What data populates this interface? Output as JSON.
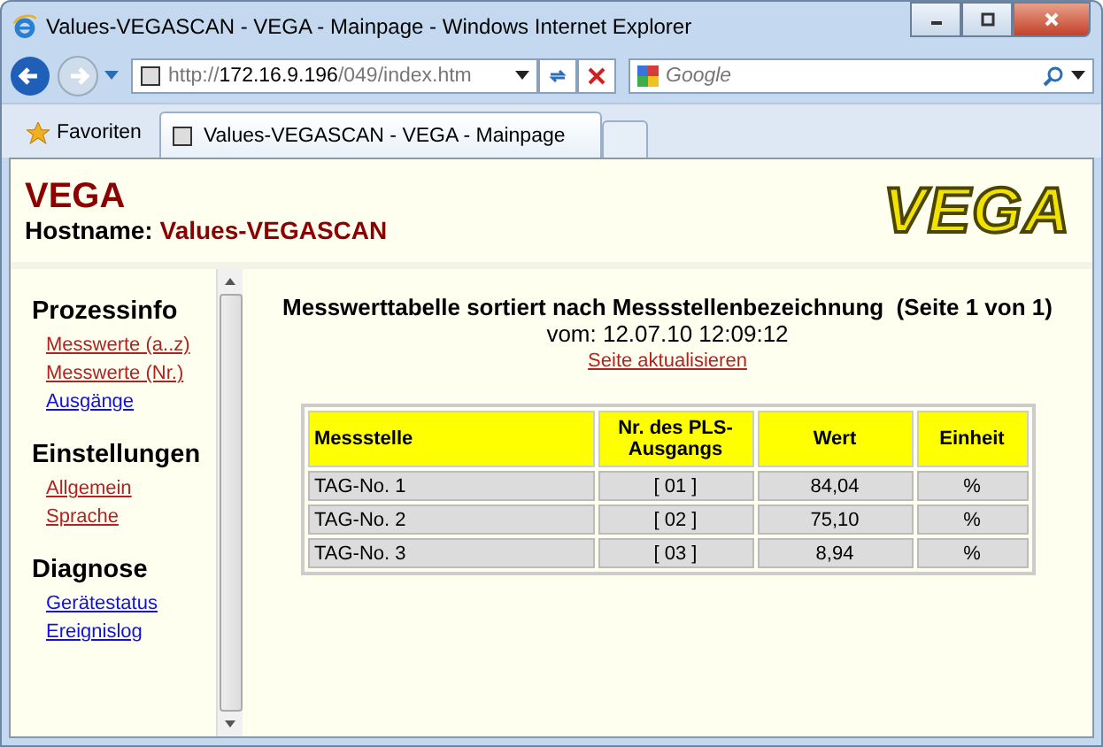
{
  "window": {
    "title": "Values-VEGASCAN - VEGA - Mainpage - Windows Internet Explorer"
  },
  "address_bar": {
    "prefix": "http://",
    "host": "172.16.9.196",
    "path": "/049/index.htm"
  },
  "search": {
    "placeholder": "Google"
  },
  "favorites": "Favoriten",
  "tabs": [
    {
      "label": "Values-VEGASCAN - VEGA - Mainpage",
      "selected": true
    }
  ],
  "header": {
    "title": "VEGA",
    "hostname_label": "Hostname:",
    "hostname": "Values-VEGASCAN",
    "logo": "VEGA"
  },
  "sidebar": {
    "sections": [
      {
        "title": "Prozessinfo",
        "links": [
          {
            "label": "Messwerte (a..z)",
            "visited": true
          },
          {
            "label": "Messwerte (Nr.)",
            "visited": true
          },
          {
            "label": "Ausgänge",
            "visited": false
          }
        ]
      },
      {
        "title": "Einstellungen",
        "links": [
          {
            "label": "Allgemein",
            "visited": true
          },
          {
            "label": "Sprache",
            "visited": true
          }
        ]
      },
      {
        "title": "Diagnose",
        "links": [
          {
            "label": "Gerätestatus",
            "visited": false
          },
          {
            "label": "Ereignislog",
            "visited": false
          }
        ]
      }
    ]
  },
  "main": {
    "heading": "Messwerttabelle sortiert nach Messstellenbezeichnung  (Seite 1 von 1)",
    "timestamp": "vom: 12.07.10 12:09:12",
    "refresh_link": {
      "label": "Seite aktualisieren",
      "visited": true
    }
  },
  "table": {
    "columns": [
      "Messstelle",
      "Nr. des PLS-Ausgangs",
      "Wert",
      "Einheit"
    ],
    "rows": [
      [
        "TAG-No. 1",
        "[ 01 ]",
        "84,04",
        "%"
      ],
      [
        "TAG-No. 2",
        "[ 02 ]",
        "75,10",
        "%"
      ],
      [
        "TAG-No. 3",
        "[ 03 ]",
        "8,94",
        "%"
      ]
    ]
  }
}
